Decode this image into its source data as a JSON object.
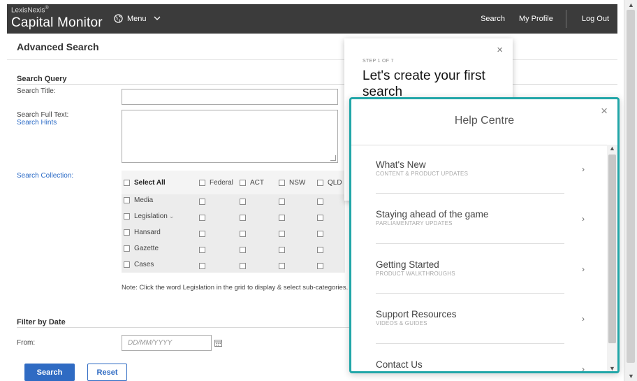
{
  "header": {
    "brand_small": "LexisNexis",
    "brand_reg": "®",
    "brand_name": "Capital Monitor",
    "menu_label": "Menu",
    "nav": {
      "search": "Search",
      "profile": "My Profile",
      "logout": "Log Out"
    }
  },
  "page": {
    "title": "Advanced Search",
    "search_query": {
      "section_title": "Search Query",
      "title_label": "Search Title:",
      "title_value": "",
      "fulltext_label": "Search Full Text:",
      "hints_link": "Search Hints",
      "fulltext_value": "",
      "collection_label": "Search Collection:"
    },
    "grid": {
      "select_all": "Select All",
      "columns": [
        "Federal",
        "ACT",
        "NSW",
        "QLD"
      ],
      "rows": [
        "Media",
        "Legislation",
        "Hansard",
        "Gazette",
        "Cases"
      ],
      "legislation_caret": "⌄"
    },
    "note": "Note: Click the word Legislation in the grid to display & select sub-categories.",
    "filter": {
      "section_title": "Filter by Date",
      "from_label": "From:",
      "from_placeholder": "DD/MM/YYYY"
    },
    "buttons": {
      "search": "Search",
      "reset": "Reset"
    }
  },
  "tour": {
    "step": "STEP 1 OF 7",
    "heading": "Let's create your first search",
    "close": "×"
  },
  "help": {
    "title": "Help Centre",
    "close": "×",
    "items": [
      {
        "title": "What's New",
        "subtitle": "CONTENT & PRODUCT UPDATES"
      },
      {
        "title": "Staying ahead of the game",
        "subtitle": "PARLIAMENTARY UPDATES"
      },
      {
        "title": "Getting Started",
        "subtitle": "PRODUCT WALKTHROUGHS"
      },
      {
        "title": "Support Resources",
        "subtitle": "VIDEOS & GUIDES"
      },
      {
        "title": "Contact Us",
        "subtitle": ""
      }
    ],
    "chevron": "›"
  },
  "colors": {
    "topbar": "#3b3b3b",
    "primary": "#2f6bc3",
    "teal_border": "#21a6a8",
    "link": "#2a6ac6"
  }
}
